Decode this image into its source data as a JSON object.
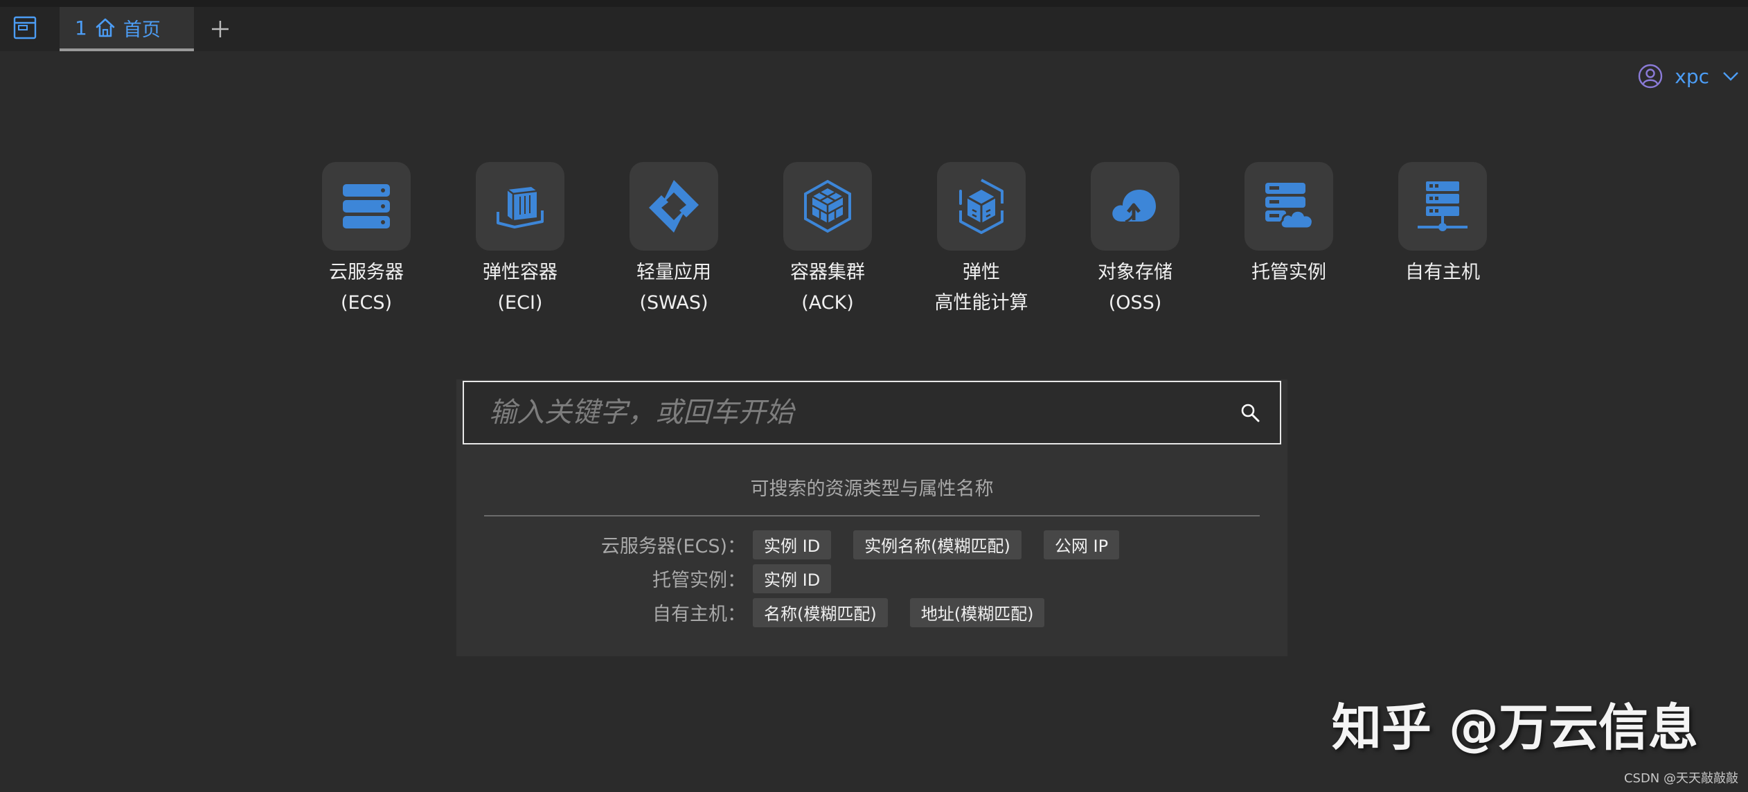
{
  "colors": {
    "accent": "#4c9df5",
    "icon_blue": "#3d86d8",
    "tile_bg": "#3b3b3b",
    "page_bg": "#2b2b2b",
    "chip_bg": "#474747",
    "avatar_purple": "#8b7bd8"
  },
  "tabbar": {
    "tabs": [
      {
        "index": "1",
        "icon": "home-icon",
        "label": "首页",
        "active": true
      }
    ],
    "add_icon": "plus-icon",
    "window_icon": "window-icon"
  },
  "user": {
    "name": "xpc",
    "icon": "user-circle-icon",
    "menu_icon": "chevron-down-icon"
  },
  "services": [
    {
      "line1": "云服务器",
      "line2": "(ECS)",
      "icon": "server-stack-icon"
    },
    {
      "line1": "弹性容器",
      "line2": "(ECI)",
      "icon": "container-box-icon"
    },
    {
      "line1": "轻量应用",
      "line2": "(SWAS)",
      "icon": "lightweight-app-icon"
    },
    {
      "line1": "容器集群",
      "line2": "(ACK)",
      "icon": "container-cluster-icon"
    },
    {
      "line1": "弹性",
      "line2": "高性能计算",
      "icon": "hpc-icon"
    },
    {
      "line1": "对象存储",
      "line2": "(OSS)",
      "icon": "cloud-upload-icon"
    },
    {
      "line1": "托管实例",
      "line2": "",
      "icon": "managed-instance-icon"
    },
    {
      "line1": "自有主机",
      "line2": "",
      "icon": "own-host-icon"
    }
  ],
  "search": {
    "placeholder": "输入关键字，或回车开始",
    "value": "",
    "icon": "search-icon"
  },
  "hints": {
    "title": "可搜索的资源类型与属性名称",
    "rows": [
      {
        "label": "云服务器(ECS)：",
        "chips": [
          "实例 ID",
          "实例名称(模糊匹配)",
          "公网 IP"
        ]
      },
      {
        "label": "托管实例：",
        "chips": [
          "实例 ID"
        ]
      },
      {
        "label": "自有主机：",
        "chips": [
          "名称(模糊匹配)",
          "地址(模糊匹配)"
        ]
      }
    ]
  },
  "watermark": {
    "text": "知乎 @万云信息",
    "credit": "CSDN @天天敲敲敲"
  }
}
